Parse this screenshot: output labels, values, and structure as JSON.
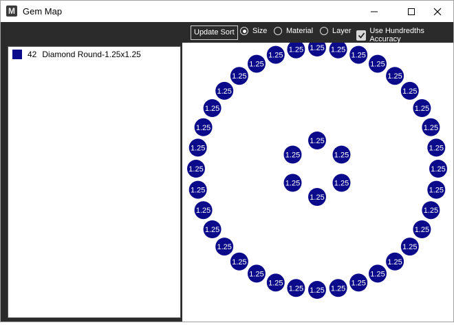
{
  "window": {
    "title": "Gem Map",
    "app_icon_glyph": "M",
    "controls": [
      "minimize-icon",
      "maximize-icon",
      "close-icon"
    ]
  },
  "toolbar": {
    "update_sort_label": "Update Sort",
    "sort_options": [
      {
        "label": "Size",
        "selected": true
      },
      {
        "label": "Material",
        "selected": false
      },
      {
        "label": "Layer",
        "selected": false
      }
    ],
    "hundredths_label": "Use Hundredths Accuracy",
    "hundredths_checked": true
  },
  "gem_list": [
    {
      "color": "#0a0a8a",
      "count": "42",
      "name": "Diamond Round-1.25x1.25"
    }
  ],
  "gem_map": {
    "gem_color": "#0a0a8a",
    "gem_label": "1.25",
    "outer_ring_count": 36,
    "inner_ring_count": 6
  }
}
